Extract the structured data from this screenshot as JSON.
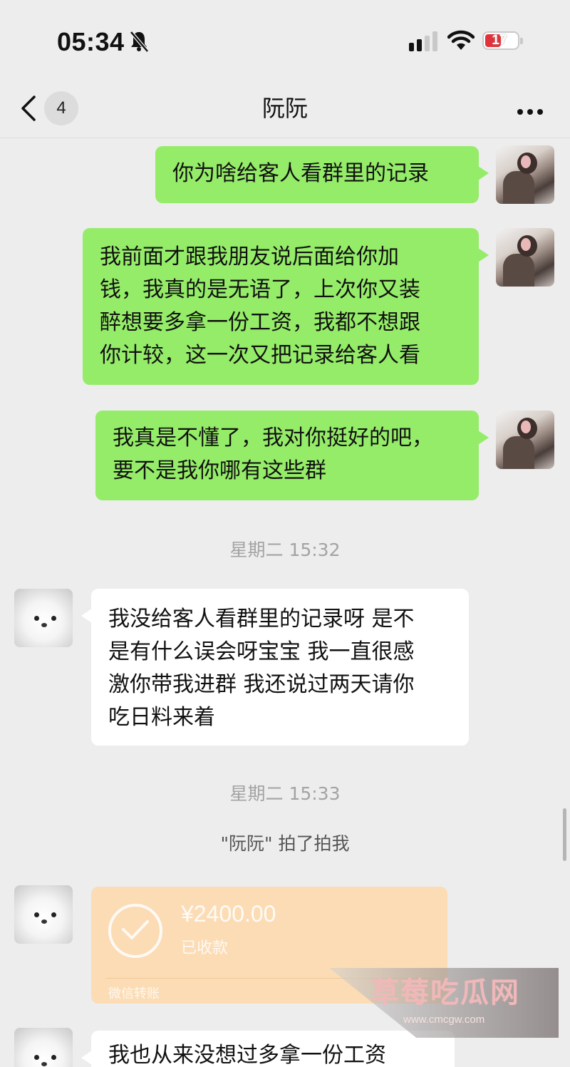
{
  "status_bar": {
    "time": "05:34",
    "battery": "17"
  },
  "header": {
    "back_count": "4",
    "title": "阮阮"
  },
  "messages": [
    {
      "side": "right",
      "text": "你为啥给客人看群里的记录"
    },
    {
      "side": "right",
      "lines": [
        "我前面才跟我朋友说后面给你加",
        "钱，我真的是无语了，上次你又装",
        "醉想要多拿一份工资，我都不想跟",
        "你计较，这一次又把记录给客人看"
      ]
    },
    {
      "side": "right",
      "lines": [
        "我真是不懂了，我对你挺好的吧，",
        "要不是我你哪有这些群"
      ]
    },
    {
      "side": "left",
      "lines": [
        "我没给客人看群里的记录呀 是不",
        "是有什么误会呀宝宝 我一直很感",
        "激你带我进群 我还说过两天请你",
        "吃日料来着"
      ]
    },
    {
      "side": "left",
      "text": "我也从来没想过多拿一份工资 "
    }
  ],
  "timestamps": [
    "星期二 15:32",
    "星期二 15:33"
  ],
  "system_message": "\"阮阮\" 拍了拍我",
  "transfer": {
    "amount": "¥2400.00",
    "status": "已收款",
    "footer": "微信转账"
  },
  "watermark": {
    "name": "草莓吃瓜网",
    "url": "www.cmcgw.com"
  },
  "colors": {
    "background": "#ededed",
    "bubble_green": "#95ec69",
    "bubble_white": "#ffffff",
    "transfer_received": "#fbdcb5"
  }
}
